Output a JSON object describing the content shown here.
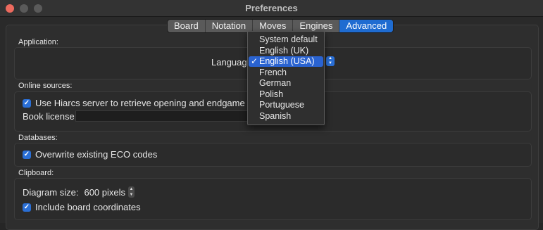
{
  "window": {
    "title": "Preferences"
  },
  "tabs": [
    {
      "label": "Board",
      "active": false
    },
    {
      "label": "Notation",
      "active": false
    },
    {
      "label": "Moves",
      "active": false
    },
    {
      "label": "Engines",
      "active": false
    },
    {
      "label": "Advanced",
      "active": true
    }
  ],
  "application": {
    "section_label": "Application:",
    "language_label": "Language"
  },
  "online_sources": {
    "section_label": "Online sources:",
    "hiarcs_checkbox_label": "Use Hiarcs server to retrieve opening and endgame informa",
    "hiarcs_checked": true,
    "book_license_label": "Book license:",
    "book_license_value": ""
  },
  "databases": {
    "section_label": "Databases:",
    "overwrite_eco_label": "Overwrite existing ECO codes",
    "overwrite_eco_checked": true
  },
  "clipboard": {
    "section_label": "Clipboard:",
    "diagram_size_label": "Diagram size:",
    "diagram_size_value": "600 pixels",
    "include_coords_label": "Include board coordinates",
    "include_coords_checked": true
  },
  "language_menu": {
    "items": [
      "System default",
      "English (UK)",
      "English (USA)",
      "French",
      "German",
      "Polish",
      "Portuguese",
      "Spanish"
    ],
    "selected": "English (USA)",
    "check_glyph": "✓"
  },
  "colors": {
    "accent": "#2a63d1",
    "close": "#ed6a5e"
  }
}
